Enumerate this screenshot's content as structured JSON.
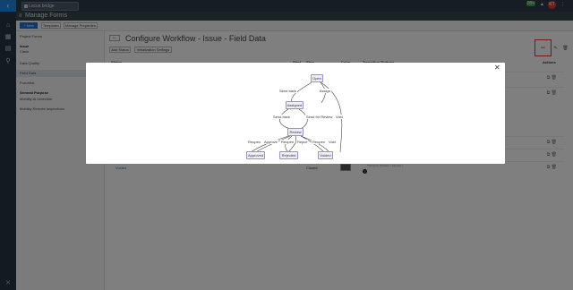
{
  "topbar": {
    "app_tab": "Locus bridge",
    "badge": "99+",
    "avatar_initials": "KT"
  },
  "header": {
    "title": "Manage Forms"
  },
  "subbar": {
    "new_label": "+ New",
    "templates_label": "Templates",
    "manage_props_label": "Manage Properties"
  },
  "sidebar": {
    "items_top": [
      "Project Forms"
    ],
    "group_issue": "Issue",
    "items_issue": [
      "Clash",
      "Data Quality",
      "Field Data",
      "Punchlist"
    ],
    "group_general": "General Purpose",
    "items_general": [
      "Mobility AI Detection",
      "Mobility Remote Inspections"
    ]
  },
  "page": {
    "title": "Configure Workflow - Issue - Field Data",
    "add_status": "Add Status",
    "init_settings": "Initialization Settings"
  },
  "table": {
    "headers": {
      "status": "Status",
      "start": "Start",
      "stop": "Stop",
      "color": "Color",
      "transition": "Transition Buttons",
      "actions": "Actions"
    },
    "last_row": {
      "status": "Voided",
      "stop": "Closed",
      "transition": "Transition (Voided -> Review )"
    }
  },
  "diagram": {
    "nodes": {
      "open": "Open",
      "assigned": "Assigned",
      "review": "Review",
      "approved": "Approved",
      "rejected": "Rejected",
      "voided": "Voided"
    },
    "edges": {
      "send_back_1": "Send back",
      "assign": "Assign",
      "send_back_2": "Send back",
      "send_for_review": "Send for Review",
      "void_1": "Void",
      "reopen_1": "Reopen",
      "approve": "Approve",
      "reopen_2": "Reopen",
      "reject": "Reject",
      "reopen_3": "Reopen",
      "void_2": "Void"
    }
  },
  "colors": {
    "accent": "#1e6fd9",
    "node_border": "#9b8fd8",
    "node_fill": "#efedfb",
    "highlight": "#e53935"
  }
}
